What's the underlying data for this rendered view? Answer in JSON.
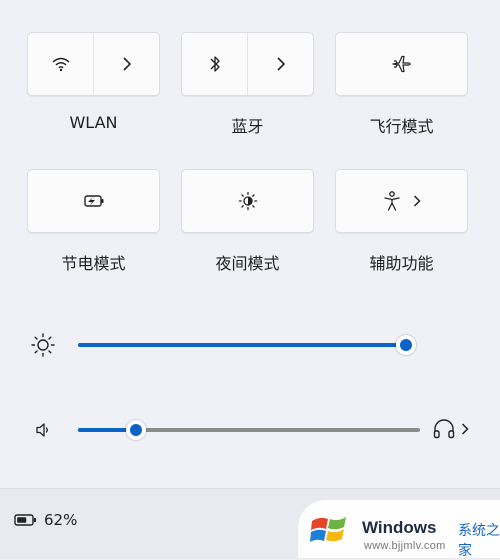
{
  "quick_settings": {
    "tiles": [
      {
        "label": "WLAN",
        "icon": "wifi-icon",
        "expand_icon": "chevron-right-icon"
      },
      {
        "label": "蓝牙",
        "icon": "bluetooth-icon",
        "expand_icon": "chevron-right-icon"
      },
      {
        "label": "飞行模式",
        "icon": "airplane-icon"
      },
      {
        "label": "节电模式",
        "icon": "battery-saver-icon"
      },
      {
        "label": "夜间模式",
        "icon": "night-light-icon"
      },
      {
        "label": "辅助功能",
        "icon": "accessibility-icon",
        "expand_icon": "chevron-right-icon"
      }
    ]
  },
  "brightness": {
    "icon": "brightness-icon",
    "level": 1.0
  },
  "volume": {
    "icon": "speaker-icon",
    "level": 0.17,
    "output_icon": "headphones-icon",
    "expand_icon": "chevron-right-icon"
  },
  "footer": {
    "battery_icon": "battery-icon",
    "battery_text": "62%"
  },
  "watermark": {
    "title": "Windows",
    "subtitle": "系统之家",
    "url": "www.bjjmlv.com"
  },
  "colors": {
    "accent": "#0b63c8",
    "track": "#8c8c8c",
    "tile_bg": "#fbfbfc",
    "panel_bg": "#eff1f6"
  }
}
